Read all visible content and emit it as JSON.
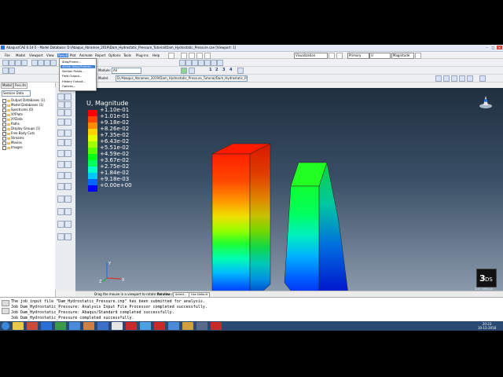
{
  "window": {
    "title": "Abaqus/CAE 6.14-5 - Model Database: D:\\Abaqus_Abramee_2019\\Dam_Hydrostatic_Pressure_Tutorial\\Dam_Hydrostatic_Pressure.cae [Viewport: 1]",
    "controls": [
      "–",
      "□",
      "✕"
    ]
  },
  "menubar": {
    "items": [
      "File",
      "Model",
      "Viewport",
      "View",
      "Result",
      "Plot",
      "Animate",
      "Report",
      "Options",
      "Tools",
      "Plug-ins",
      "Help"
    ],
    "active": "Result",
    "right_field": "Visualization defaults",
    "primary_label": "Primary",
    "primary_value": "U",
    "magnitude_value": "Magnitude"
  },
  "result_menu": {
    "items": [
      "Step/Frame...",
      "Active Steps/Frames...",
      "Section Points...",
      "Field Output...",
      "History Output...",
      "Options..."
    ],
    "selected": "Active Steps/Frames..."
  },
  "toolbar": {
    "module_label": "Module:",
    "module_value": "Visualization",
    "model_label": "Model:",
    "model_value": "D:/Abaqus_Abramee_2019/Dam_Hydrostatic_Pressure_Tutorial/Dam_Hydrostatic_Pressure.odb",
    "all_value": "All",
    "numbers": [
      "1",
      "2",
      "3",
      "4"
    ]
  },
  "tree": {
    "tabs": [
      "Model",
      "Results"
    ],
    "active_tab": "Results",
    "session_label": "Session Data",
    "nodes": [
      "Output Databases (1)",
      "Model Databases (1)",
      "Spectrums (0)",
      "XYPlots",
      "XYData",
      "Paths",
      "Display Groups (1)",
      "Free Body Cuts",
      "Streams",
      "Movies",
      "Images"
    ]
  },
  "viewport": {
    "legend_title": "U, Magnitude",
    "legend_values": [
      "+1.10e-01",
      "+1.01e-01",
      "+9.18e-02",
      "+8.26e-02",
      "+7.35e-02",
      "+6.43e-02",
      "+5.51e-02",
      "+4.59e-02",
      "+3.67e-02",
      "+2.75e-02",
      "+1.84e-02",
      "+9.18e-03",
      "+0.00e+00"
    ],
    "legend_colors": [
      "#ff0000",
      "#ff4600",
      "#ff8c00",
      "#ffd200",
      "#e6ff00",
      "#a0ff00",
      "#5aff00",
      "#00ff14",
      "#00ff5a",
      "#00ffc8",
      "#00c8ff",
      "#0064ff",
      "#0000ff"
    ],
    "triad_labels": [
      "Y",
      "Z",
      "X"
    ],
    "brand": "3DS SIMULIA"
  },
  "statusbar": {
    "hint": "Drag the mouse in a viewport to rotate the view",
    "center_label": "Rotation center:",
    "select_button": "Select...",
    "default_button": "Use Default"
  },
  "messages": [
    "The job input file \"Dam_Hydrostatic_Pressure.inp\" has been submitted for analysis.",
    "Job Dam_Hydrostatic_Pressure: Analysis Input File Processor completed successfully.",
    "Job Dam_Hydrostatic_Pressure: Abaqus/Standard completed successfully.",
    "Job Dam_Hydrostatic_Pressure completed successfully."
  ],
  "taskbar": {
    "time": "20:23",
    "date": "10-12-2018"
  }
}
